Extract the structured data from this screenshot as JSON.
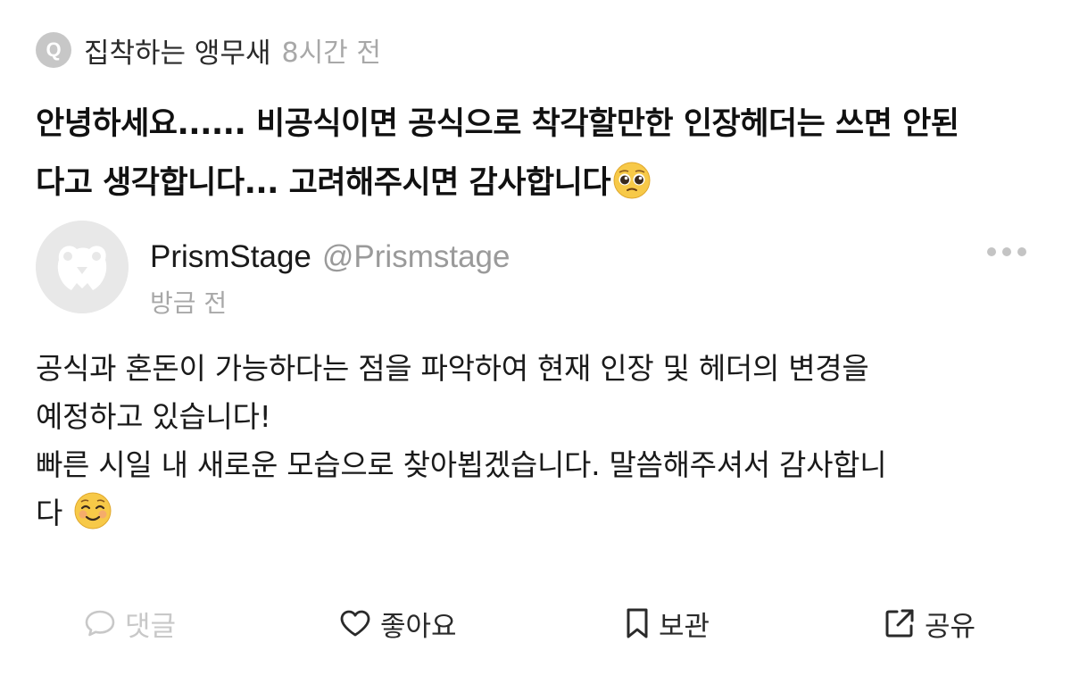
{
  "question": {
    "badge_letter": "Q",
    "author": "집착하는 앵무새",
    "time": "8시간 전",
    "lines": [
      "안녕하세요...... 비공식이면 공식으로 착각할만한 인장헤더는 쓰면 안된",
      "다고 생각합니다... 고려해주시면 감사합니다"
    ],
    "emoji": "pleading-face-emoji"
  },
  "answer": {
    "name": "PrismStage",
    "handle": "@Prismstage",
    "time": "방금 전",
    "avatar_icon": "panda-default-avatar-icon",
    "lines": [
      "공식과 혼돈이 가능하다는 점을 파악하여 현재 인장 및 헤더의 변경을",
      "예정하고 있습니다!",
      "빠른 시일 내 새로운 모습으로 찾아뵙겠습니다. 말씀해주셔서 감사합니",
      "다"
    ],
    "emoji": "smiling-face-emoji"
  },
  "actions": {
    "comment": "댓글",
    "like": "좋아요",
    "save": "보관",
    "share": "공유"
  },
  "colors": {
    "muted": "#a8a8a8",
    "disabled": "#c8c8c8",
    "text": "#1a1a1a",
    "avatar_bg": "#e8e8e8"
  }
}
